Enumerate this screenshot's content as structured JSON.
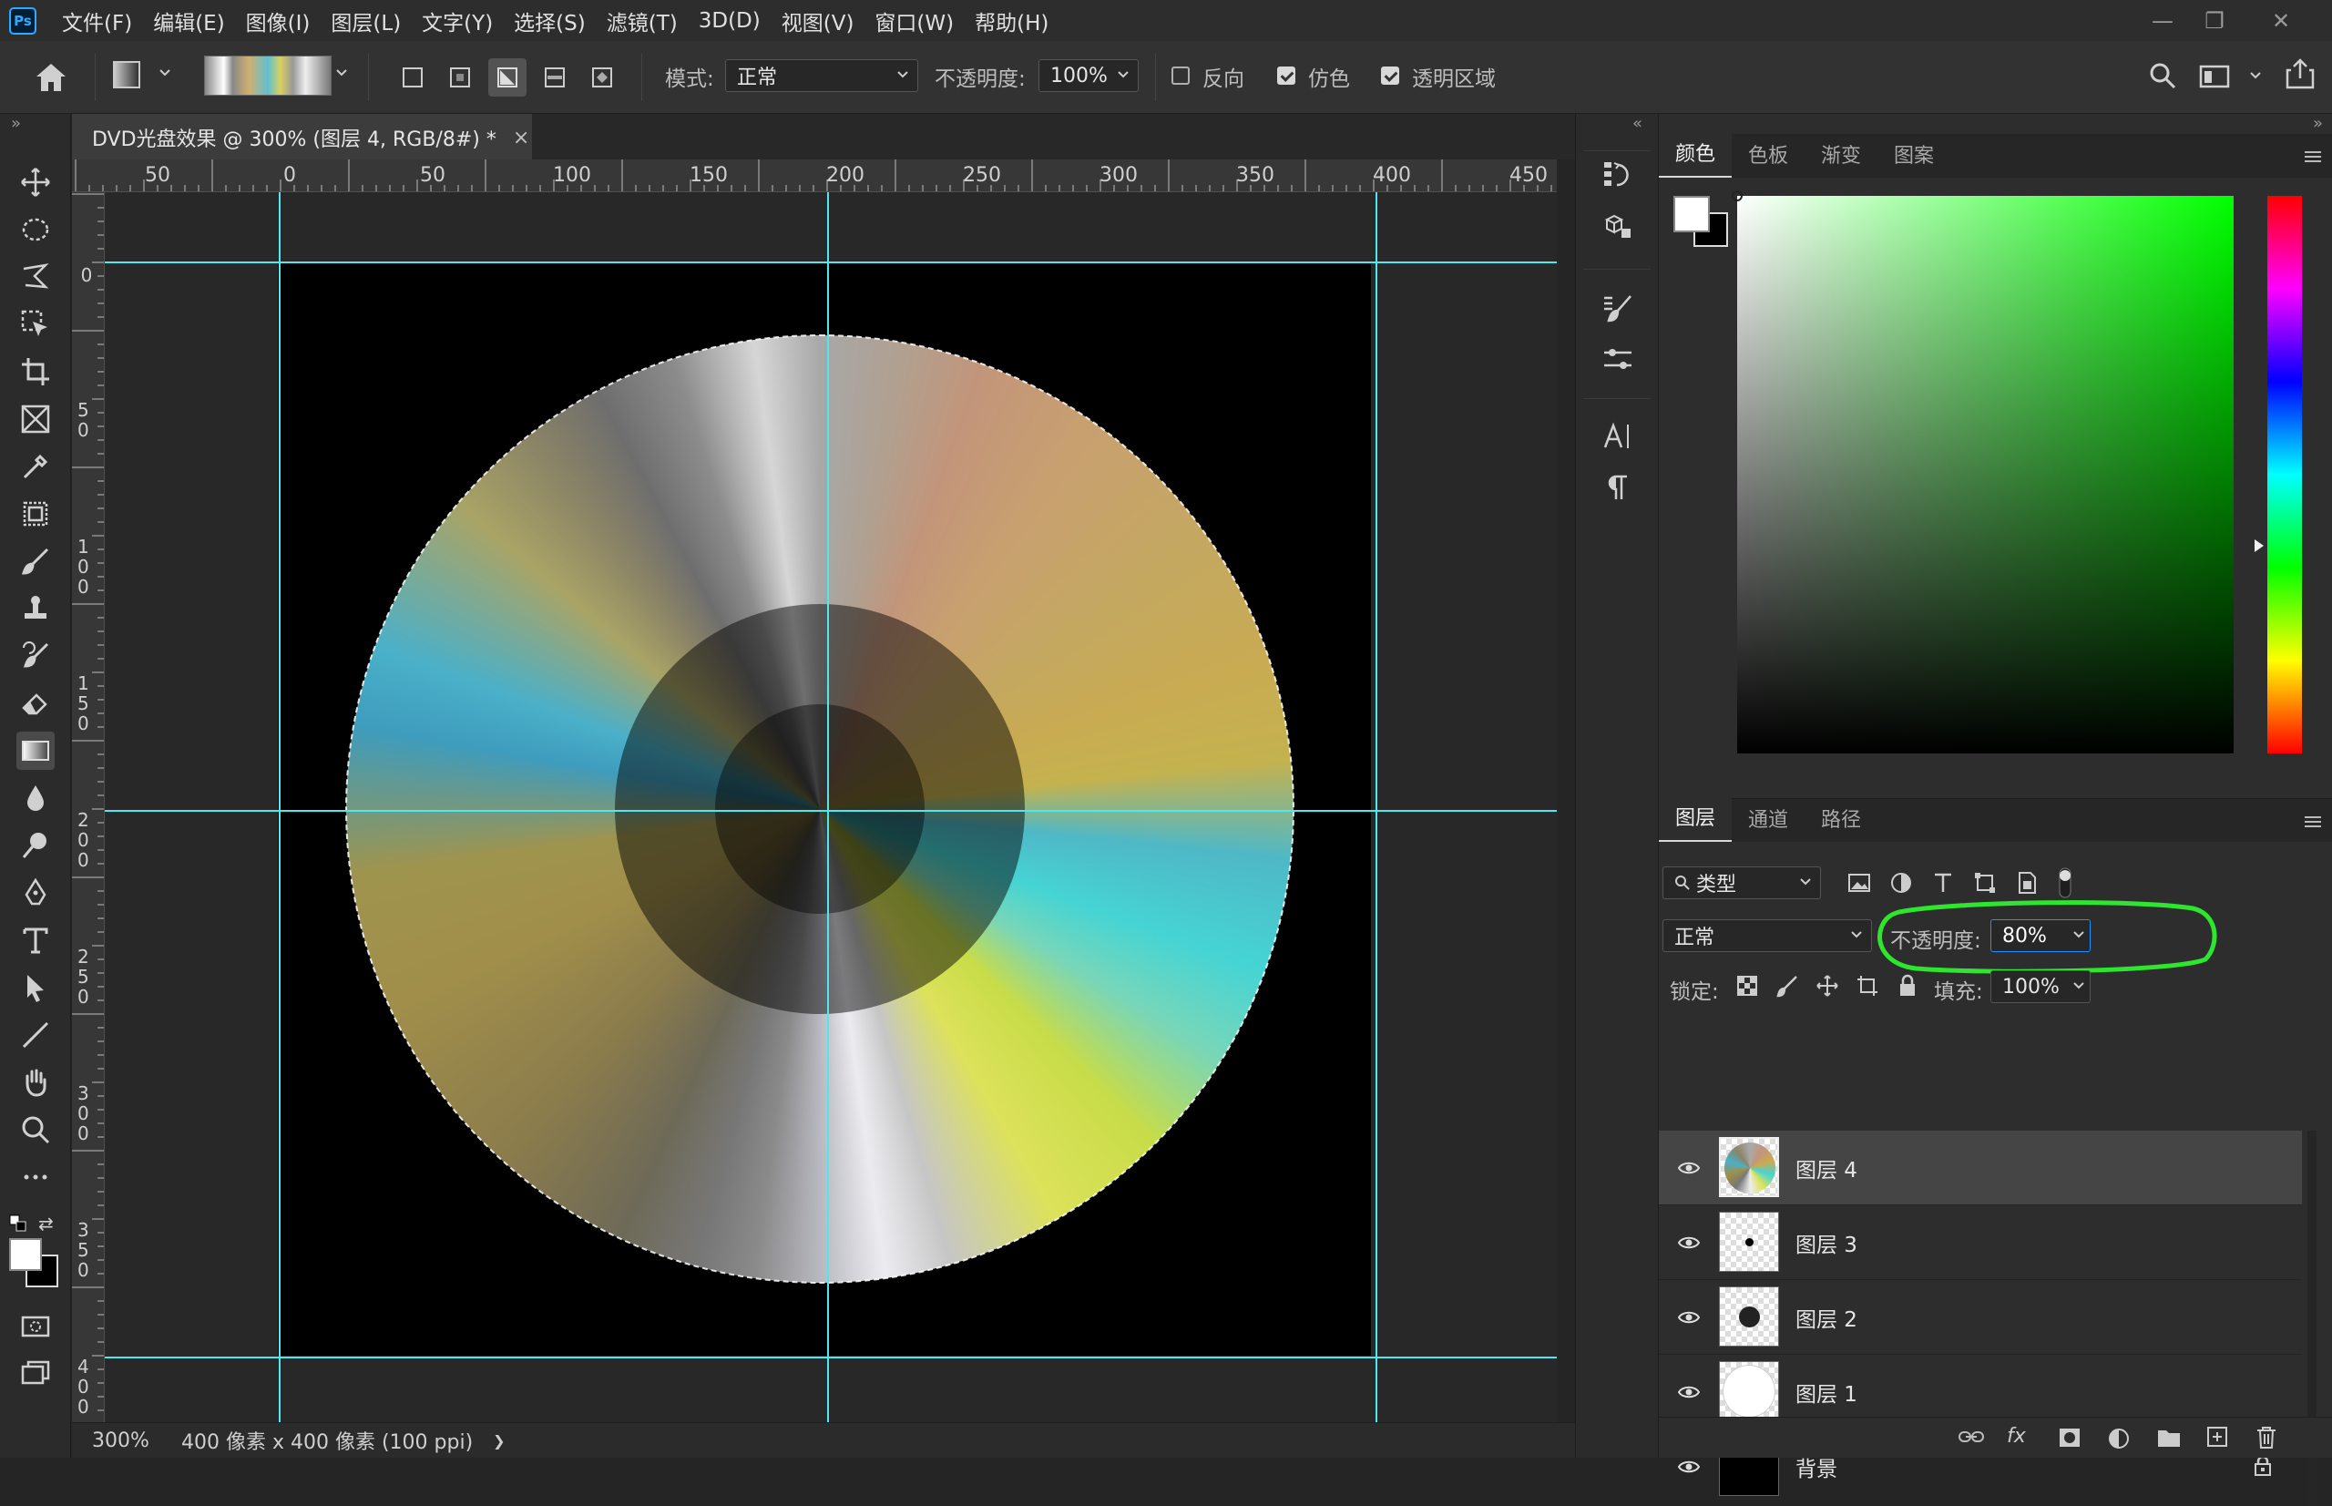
{
  "app": {
    "logo": "Ps"
  },
  "menu": [
    "文件(F)",
    "编辑(E)",
    "图像(I)",
    "图层(L)",
    "文字(Y)",
    "选择(S)",
    "滤镜(T)",
    "3D(D)",
    "视图(V)",
    "窗口(W)",
    "帮助(H)"
  ],
  "window_controls": {
    "minimize": "—",
    "restore": "❐",
    "close": "✕"
  },
  "options": {
    "mode_label": "模式:",
    "mode_value": "正常",
    "opacity_label": "不透明度:",
    "opacity_value": "100%",
    "reverse_label": "反向",
    "reverse_checked": false,
    "dither_label": "仿色",
    "dither_checked": true,
    "transparency_label": "透明区域",
    "transparency_checked": true
  },
  "document": {
    "tab_title": "DVD光盘效果 @ 300% (图层 4, RGB/8#) *",
    "close_glyph": "×",
    "zoom": "300%",
    "doc_info": "400 像素 x 400 像素 (100 ppi)",
    "status_arrow": "❯"
  },
  "ruler": {
    "h_labels": [
      "50",
      "0",
      "50",
      "100",
      "150",
      "200",
      "250",
      "300",
      "350",
      "400",
      "450"
    ],
    "v_labels": [
      "0",
      "5 0",
      "1 0 0",
      "1 5 0",
      "2 0 0",
      "2 5 0",
      "3 0 0",
      "3 5 0",
      "4 0 0"
    ]
  },
  "color_panel": {
    "tabs": [
      "颜色",
      "色板",
      "渐变",
      "图案"
    ],
    "active_tab": "颜色",
    "foreground": "#ffffff",
    "background": "#000000",
    "hue_color": "#00ff00"
  },
  "layers_panel": {
    "tabs": [
      "图层",
      "通道",
      "路径"
    ],
    "active_tab": "图层",
    "filter_label": "类型",
    "blend_mode": "正常",
    "opacity_label": "不透明度:",
    "opacity_value": "80%",
    "lock_label": "锁定:",
    "fill_label": "填充:",
    "fill_value": "100%",
    "layers": [
      {
        "name": "图层 4",
        "visible": true,
        "selected": true,
        "thumb": "disc"
      },
      {
        "name": "图层 3",
        "visible": true,
        "selected": false,
        "thumb": "small-dot"
      },
      {
        "name": "图层 2",
        "visible": true,
        "selected": false,
        "thumb": "medium-dot"
      },
      {
        "name": "图层 1",
        "visible": true,
        "selected": false,
        "thumb": "white-circle"
      },
      {
        "name": "背景",
        "visible": true,
        "selected": false,
        "thumb": "black",
        "locked": true
      }
    ]
  },
  "colors": {
    "guide": "#4de8f0",
    "highlight_annotation": "#2ee62e",
    "ps_blue": "#31a8ff"
  }
}
